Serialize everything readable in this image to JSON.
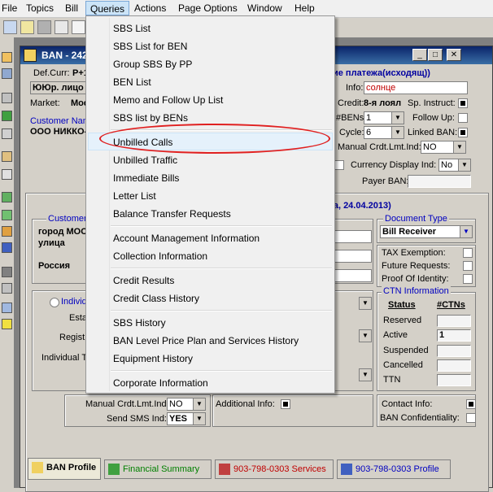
{
  "menubar": {
    "items": [
      "File",
      "Topics",
      "Bill",
      "Queries",
      "Actions",
      "Page Options",
      "Window",
      "Help"
    ]
  },
  "window": {
    "title": "BAN - 242",
    "header_red": "ие платежа(исходящ))"
  },
  "form": {
    "def_curr_label": "Def.Curr:",
    "def_curr_value": "P+1",
    "type_value": "ЮЮр. лицо V",
    "market_label": "Market:",
    "market_value": "Мос",
    "customer_name_label": "Customer Nam",
    "customer_name_value": "ООО НИККО-",
    "info_label": "Info:",
    "info_value": "солнце",
    "credit_label": "Credit:",
    "credit_value": "8-я лоял",
    "sp_instruct_label": "Sp. Instruct:",
    "bens_label": "#BENs:",
    "bens_value": "1",
    "follow_up_label": "Follow Up:",
    "cycle_label": "Cycle:",
    "cycle_value": "6",
    "linked_ban_label": "Linked BAN:",
    "manual_crdt_label": "Manual Crdt.Lmt.Ind:",
    "manual_crdt_value": "NO",
    "currency_display_label": "Currency Display Ind:",
    "currency_display_value": "No",
    "payer_ban_label": "Payer BAN:",
    "section_title": "ova, 24.04.2013)",
    "customer_group_title": "Customer",
    "address_city": "город МОС",
    "address_street": "улица",
    "address_country": "Россия",
    "document_type_title": "Document Type",
    "document_type_value": "Bill Receiver",
    "tax_exemption_label": "TAX Exemption:",
    "future_requests_label": "Future Requests:",
    "proof_identity_label": "Proof Of Identity:",
    "ctn_info_title": "CTN Information",
    "ctn_status_header": "Status",
    "ctn_count_header": "#CTNs",
    "ctn_rows": [
      {
        "status": "Reserved",
        "count": ""
      },
      {
        "status": "Active",
        "count": "1"
      },
      {
        "status": "Suspended",
        "count": ""
      },
      {
        "status": "Cancelled",
        "count": ""
      },
      {
        "status": "TTN",
        "count": ""
      }
    ],
    "individ_label": "Individ",
    "esta_label": "Esta",
    "regist_label": "Regist",
    "individual_ta_label": "Individual Ta",
    "manual_crdt2_label": "Manual Crdt.Lmt.Ind:",
    "manual_crdt2_value": "NO",
    "send_sms_label": "Send SMS Ind:",
    "send_sms_value": "YES",
    "additional_info_label": "Additional Info:",
    "contact_info_label": "Contact Info:",
    "ban_confidentiality_label": "BAN Confidentiality:"
  },
  "tabs": [
    {
      "label": "BAN Profile",
      "color": "#000000"
    },
    {
      "label": "Financial Summary",
      "color": "#008000"
    },
    {
      "label": "903-798-0303 Services",
      "color": "#c00000"
    },
    {
      "label": "903-798-0303 Profile",
      "color": "#0000c0"
    }
  ],
  "queries_menu": {
    "groups": [
      [
        "SBS List",
        "SBS List for BEN",
        "Group SBS By PP",
        "BEN List",
        "Memo and Follow Up List",
        "SBS list by BENs"
      ],
      [
        "Unbilled Calls",
        "Unbilled Traffic",
        "Immediate Bills",
        "Letter List",
        "Balance Transfer Requests"
      ],
      [
        "Account Management Information",
        "Collection Information"
      ],
      [
        "Credit Results",
        "Credit Class History"
      ],
      [
        "SBS History",
        "BAN Level Price Plan and Services History",
        "Equipment History"
      ],
      [
        "Corporate Information"
      ]
    ],
    "highlighted": "Unbilled Calls"
  },
  "colors": {
    "accent_red": "#e02020",
    "title_blue": "#0a246a",
    "link_blue": "#0000c0"
  }
}
